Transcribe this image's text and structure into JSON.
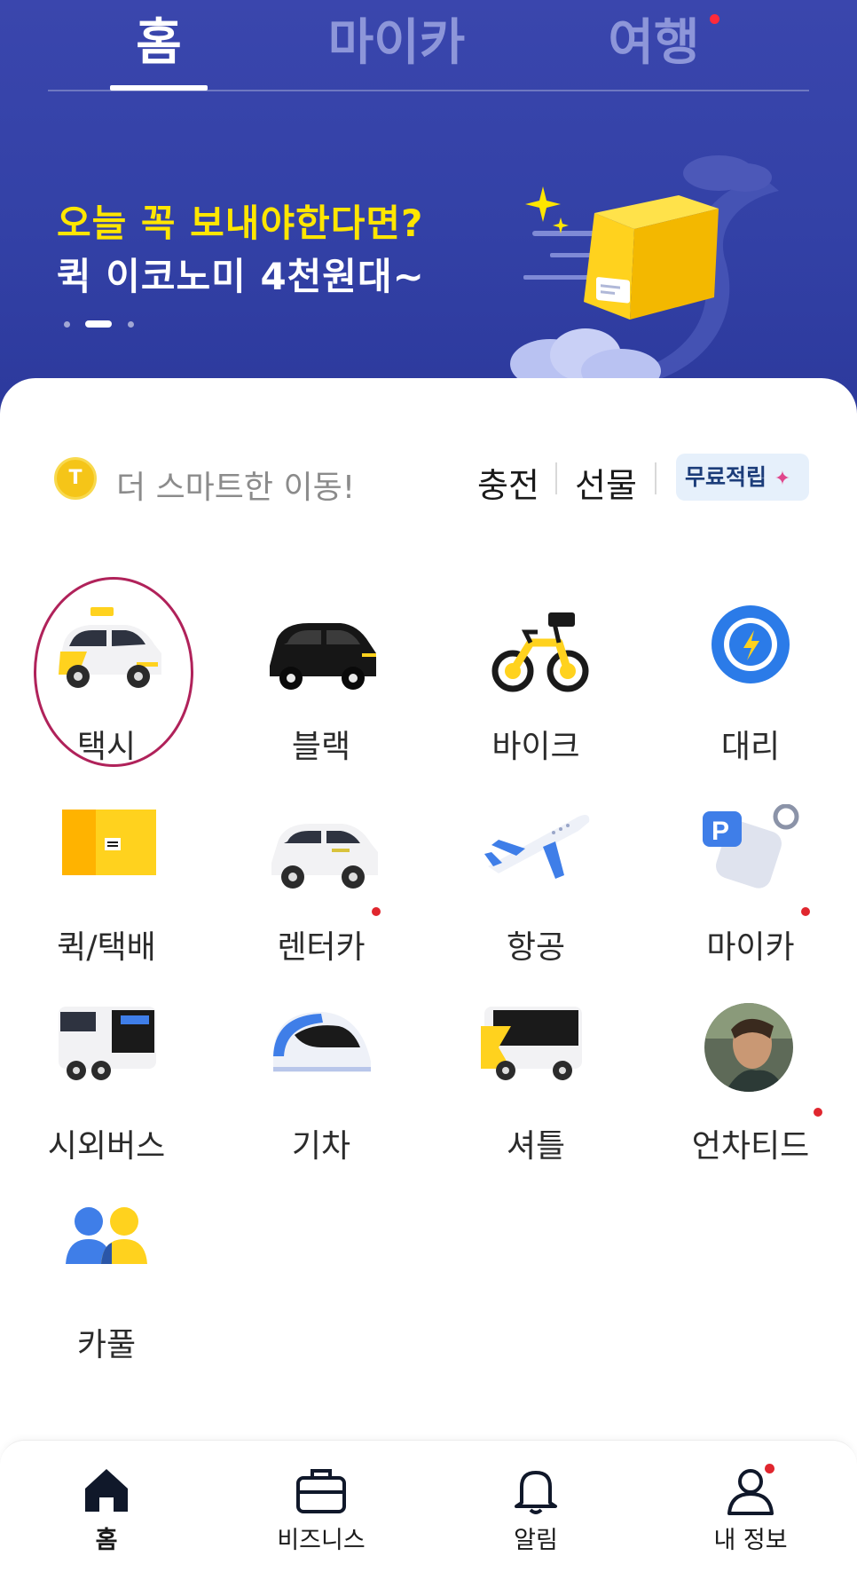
{
  "tabs": [
    {
      "label": "홈",
      "active": true
    },
    {
      "label": "마이카",
      "active": false
    },
    {
      "label": "여행",
      "active": false,
      "has_dot": true
    }
  ],
  "banner": {
    "line1": "오늘 꼭 보내야한다면?",
    "line2": "퀵 이코노미 4천원대~",
    "pager": {
      "pages": 3,
      "current": 2
    }
  },
  "points_bar": {
    "coin_letter": "T",
    "slogan": "더 스마트한 이동!",
    "charge": "충전",
    "gift": "선물",
    "free_points": "무료적립"
  },
  "services": [
    {
      "label": "택시",
      "icon": "taxi-icon",
      "highlighted": true
    },
    {
      "label": "블랙",
      "icon": "black-car-icon"
    },
    {
      "label": "바이크",
      "icon": "bike-icon"
    },
    {
      "label": "대리",
      "icon": "steering-wheel-icon"
    },
    {
      "label": "퀵/택배",
      "icon": "parcel-box-icon"
    },
    {
      "label": "렌터카",
      "icon": "rental-car-icon",
      "has_dot": true
    },
    {
      "label": "항공",
      "icon": "airplane-icon"
    },
    {
      "label": "마이카",
      "icon": "parking-key-icon",
      "has_dot": true
    },
    {
      "label": "시외버스",
      "icon": "bus-icon"
    },
    {
      "label": "기차",
      "icon": "train-icon"
    },
    {
      "label": "셔틀",
      "icon": "shuttle-icon"
    },
    {
      "label": "언차티드",
      "icon": "movie-poster-avatar",
      "has_dot": true
    },
    {
      "label": "카풀",
      "icon": "carpool-icon"
    }
  ],
  "bottom_nav": [
    {
      "label": "홈",
      "icon": "home-icon",
      "active": true
    },
    {
      "label": "비즈니스",
      "icon": "briefcase-icon"
    },
    {
      "label": "알림",
      "icon": "bell-icon"
    },
    {
      "label": "내 정보",
      "icon": "person-icon",
      "has_dot": true
    }
  ],
  "colors": {
    "header_bg": "#3341a6",
    "banner_highlight": "#ffe600",
    "notification_dot": "#e0262e",
    "highlight_ring": "#b0225a"
  }
}
